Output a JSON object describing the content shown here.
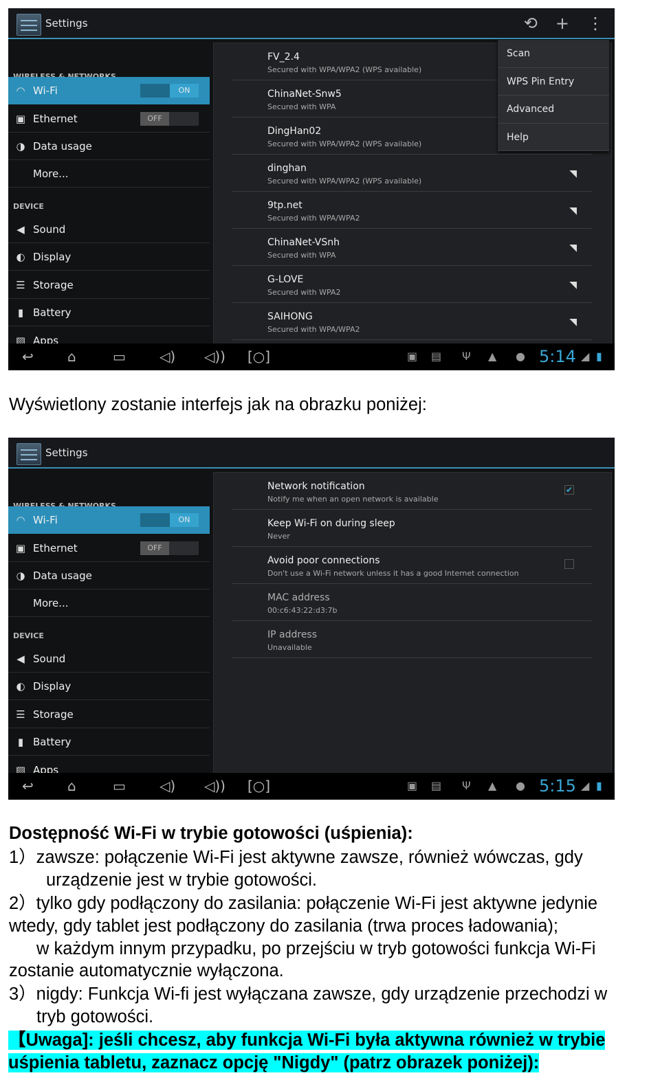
{
  "screens": [
    {
      "app_title": "Settings",
      "action_icons": [
        "refresh-icon",
        "add-icon",
        "overflow-menu-icon"
      ],
      "sidebar": {
        "headers": [
          "WIRELESS & NETWORKS",
          "DEVICE"
        ],
        "items": [
          {
            "label": "Wi-Fi",
            "icon": "wifi-icon",
            "toggle": "ON",
            "selected": true
          },
          {
            "label": "Ethernet",
            "icon": "ethernet-icon",
            "toggle": "OFF"
          },
          {
            "label": "Data usage",
            "icon": "data-usage-icon"
          },
          {
            "label": "More..."
          },
          {
            "label": "Sound",
            "icon": "speaker-icon"
          },
          {
            "label": "Display",
            "icon": "display-icon"
          },
          {
            "label": "Storage",
            "icon": "storage-icon"
          },
          {
            "label": "Battery",
            "icon": "battery-icon"
          },
          {
            "label": "Apps",
            "icon": "apps-icon"
          }
        ]
      },
      "list": [
        {
          "title": "FV_2.4",
          "subtitle": "Secured with WPA/WPA2 (WPS available)"
        },
        {
          "title": "ChinaNet-Snw5",
          "subtitle": "Secured with WPA"
        },
        {
          "title": "DingHan02",
          "subtitle": "Secured with WPA/WPA2 (WPS available)"
        },
        {
          "title": "dinghan",
          "subtitle": "Secured with WPA/WPA2 (WPS available)",
          "icon": "wifi-lock-icon"
        },
        {
          "title": "9tp.net",
          "subtitle": "Secured with WPA/WPA2",
          "icon": "wifi-lock-icon"
        },
        {
          "title": "ChinaNet-VSnh",
          "subtitle": "Secured with WPA",
          "icon": "wifi-lock-icon"
        },
        {
          "title": "G-LOVE",
          "subtitle": "Secured with WPA2",
          "icon": "wifi-lock-icon"
        },
        {
          "title": "SAIHONG",
          "subtitle": "Secured with WPA/WPA2",
          "icon": "wifi-lock-icon"
        }
      ],
      "menu": [
        "Scan",
        "WPS Pin Entry",
        "Advanced",
        "Help"
      ],
      "clock": "5:14"
    },
    {
      "app_title": "Settings",
      "action_icons": [],
      "sidebar": {
        "headers": [
          "WIRELESS & NETWORKS",
          "DEVICE"
        ],
        "items": [
          {
            "label": "Wi-Fi",
            "icon": "wifi-icon",
            "toggle": "ON",
            "selected": true
          },
          {
            "label": "Ethernet",
            "icon": "ethernet-icon",
            "toggle": "OFF"
          },
          {
            "label": "Data usage",
            "icon": "data-usage-icon"
          },
          {
            "label": "More..."
          },
          {
            "label": "Sound",
            "icon": "speaker-icon"
          },
          {
            "label": "Display",
            "icon": "display-icon"
          },
          {
            "label": "Storage",
            "icon": "storage-icon"
          },
          {
            "label": "Battery",
            "icon": "battery-icon"
          },
          {
            "label": "Apps",
            "icon": "apps-icon"
          }
        ]
      },
      "list": [
        {
          "title": "Network notification",
          "subtitle": "Notify me when an open network is available",
          "checkbox": true
        },
        {
          "title": "Keep Wi-Fi on during sleep",
          "subtitle": "Never"
        },
        {
          "title": "Avoid poor connections",
          "subtitle": "Don't use a Wi-Fi network unless it has a good Internet connection",
          "checkbox": false
        },
        {
          "title": "MAC address",
          "subtitle": "00:c6:43:22:d3:7b",
          "dim": true
        },
        {
          "title": "IP address",
          "subtitle": "Unavailable",
          "dim": true
        }
      ],
      "menu": [],
      "clock": "5:15"
    }
  ],
  "text": {
    "intro": "Wyświetlony zostanie interfejs jak na obrazku poniżej:",
    "heading": "Dostępność Wi-Fi w trybie gotowości (uśpienia):",
    "lines": [
      "1）zawsze: połączenie Wi-Fi jest aktywne zawsze, również wówczas, gdy",
      "urządzenie jest w trybie gotowości.",
      "2）tylko gdy podłączony do zasilania: połączenie Wi-Fi jest aktywne jedynie",
      "wtedy, gdy tablet jest podłączony do zasilania (trwa proces ładowania);",
      "w każdym innym przypadku, po przejściu w tryb gotowości funkcja Wi-Fi",
      "zostanie automatycznie wyłączona.",
      "3）nigdy: Funkcja Wi-fi jest wyłączana zawsze, gdy urządzenie przechodzi w",
      "tryb gotowości."
    ],
    "note": [
      "【Uwaga]: jeśli chcesz, aby funkcja Wi-Fi była aktywna również w trybie",
      "uśpienia tabletu, zaznacz opcję \"Nigdy\" (patrz obrazek poniżej):"
    ]
  },
  "colors": {
    "accent": "#2b8fb9",
    "highlight": "#00ffff"
  }
}
